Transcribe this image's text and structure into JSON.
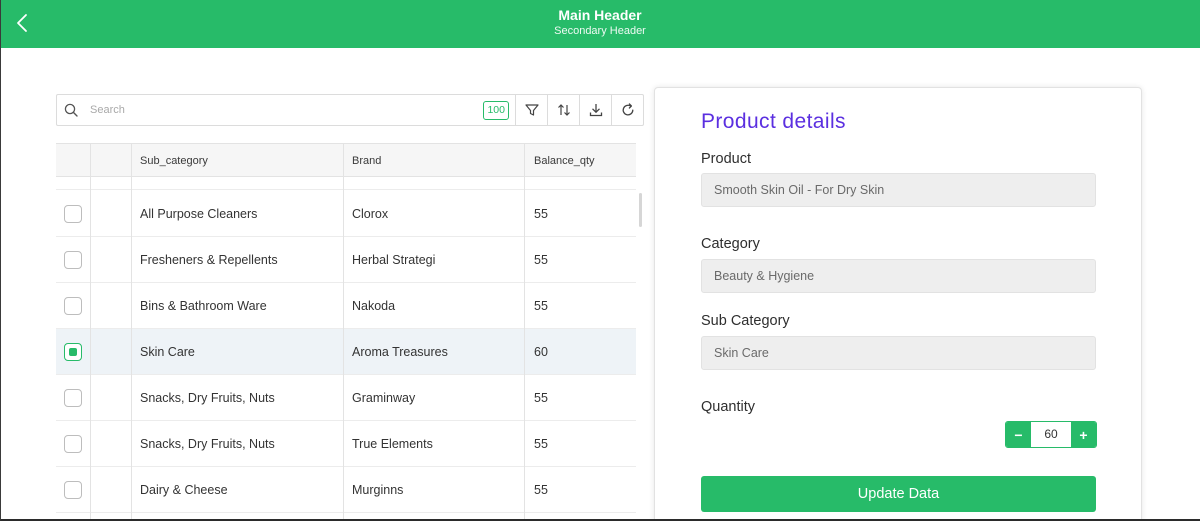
{
  "header": {
    "main_title": "Main Header",
    "secondary_title": "Secondary Header"
  },
  "toolbar": {
    "search_placeholder": "Search",
    "search_value": "",
    "record_count": "100",
    "icons": [
      "search-icon",
      "filter-icon",
      "sort-icon",
      "download-icon",
      "refresh-icon"
    ]
  },
  "table": {
    "columns": [
      "",
      "",
      "Sub_category",
      "Brand",
      "Balance_qty"
    ],
    "rows": [
      {
        "checked": false,
        "sub_category": "All Purpose Cleaners",
        "brand": "Clorox",
        "balance_qty": "55"
      },
      {
        "checked": false,
        "sub_category": "Fresheners & Repellents",
        "brand": "Herbal Strategi",
        "balance_qty": "55"
      },
      {
        "checked": false,
        "sub_category": "Bins & Bathroom Ware",
        "brand": "Nakoda",
        "balance_qty": "55"
      },
      {
        "checked": true,
        "sub_category": "Skin Care",
        "brand": "Aroma Treasures",
        "balance_qty": "60"
      },
      {
        "checked": false,
        "sub_category": "Snacks, Dry Fruits, Nuts",
        "brand": "Graminway",
        "balance_qty": "55"
      },
      {
        "checked": false,
        "sub_category": "Snacks, Dry Fruits, Nuts",
        "brand": "True Elements",
        "balance_qty": "55"
      },
      {
        "checked": false,
        "sub_category": "Dairy & Cheese",
        "brand": "Murginns",
        "balance_qty": "55"
      }
    ]
  },
  "details": {
    "title": "Product details",
    "product_label": "Product",
    "product_value": "Smooth Skin Oil - For Dry Skin",
    "category_label": "Category",
    "category_value": "Beauty & Hygiene",
    "sub_category_label": "Sub Category",
    "sub_category_value": "Skin Care",
    "quantity_label": "Quantity",
    "quantity_value": "60",
    "decrement_label": "−",
    "increment_label": "+",
    "update_label": "Update Data"
  },
  "colors": {
    "accent": "#27bb69",
    "title": "#5b2fe0",
    "selected_row": "#eef3f7"
  }
}
